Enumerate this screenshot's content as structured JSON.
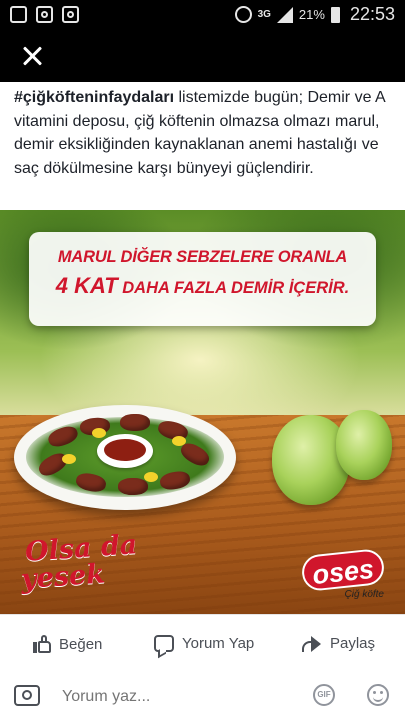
{
  "status_bar": {
    "network": "3G",
    "battery": "21%",
    "time": "22:53",
    "left_icons": [
      "gallery-icon",
      "instagram-icon",
      "instagram-icon"
    ]
  },
  "post": {
    "hashtag": "#çiğköfteninfaydaları",
    "caption": " listemizde bugün; Demir ve A vitamini deposu, çiğ köftenin olmazsa olmazı marul, demir eksikliğinden kaynaklanan anemi hastalığı ve saç dökülmesine karşı bünyeyi güçlendirir."
  },
  "ad_image": {
    "banner_line1": "MARUL DİĞER SEBZELERE ORANLA",
    "banner_line2_emphasis": "4 KAT",
    "banner_line2_rest": " DAHA FAZLA DEMİR İÇERİR.",
    "slogan_line1": "Olsa da",
    "slogan_line2": "yesek",
    "logo_word": "oses",
    "logo_sub": "Çiğ köfte",
    "accent_color": "#d0162c"
  },
  "actions": {
    "like": "Beğen",
    "comment": "Yorum Yap",
    "share": "Paylaş"
  },
  "composer": {
    "placeholder": "Yorum yaz...",
    "gif": "GIF"
  }
}
